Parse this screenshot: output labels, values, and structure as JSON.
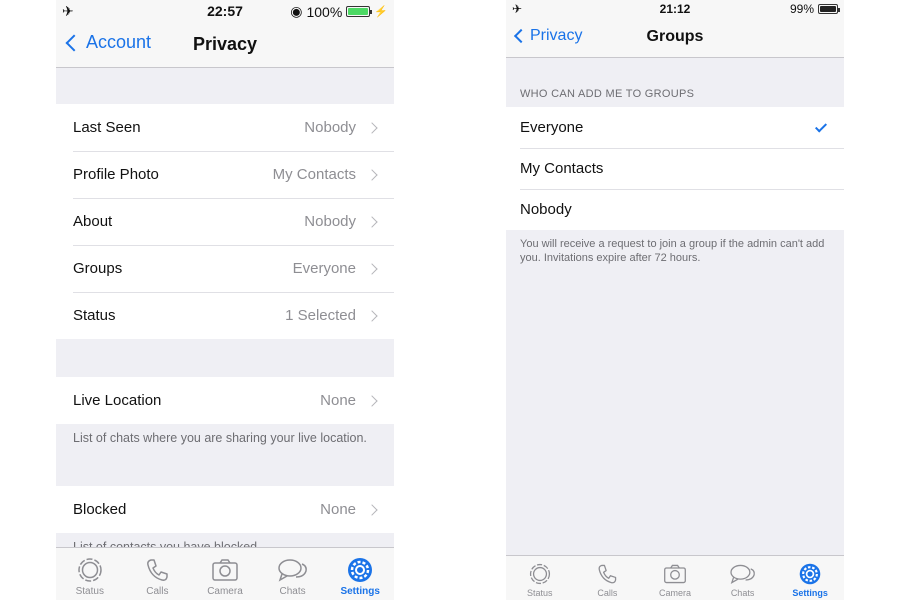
{
  "colors": {
    "accent": "#1a73e8",
    "battery_green": "#4cd964",
    "battery_dark": "#222222"
  },
  "left": {
    "statusbar": {
      "time": "22:57",
      "battery": "100%",
      "battery_level": 1.0
    },
    "nav": {
      "back_label": "Account",
      "title": "Privacy"
    },
    "rows": [
      {
        "label": "Last Seen",
        "value": "Nobody"
      },
      {
        "label": "Profile Photo",
        "value": "My Contacts"
      },
      {
        "label": "About",
        "value": "Nobody"
      },
      {
        "label": "Groups",
        "value": "Everyone"
      },
      {
        "label": "Status",
        "value": "1 Selected"
      }
    ],
    "live_location": {
      "label": "Live Location",
      "value": "None",
      "footer": "List of chats where you are sharing your live location."
    },
    "blocked": {
      "label": "Blocked",
      "value": "None",
      "footer": "List of contacts you have blocked."
    },
    "tabs": [
      {
        "label": "Status",
        "icon": "status-icon"
      },
      {
        "label": "Calls",
        "icon": "phone-icon"
      },
      {
        "label": "Camera",
        "icon": "camera-icon"
      },
      {
        "label": "Chats",
        "icon": "chat-bubbles-icon"
      },
      {
        "label": "Settings",
        "icon": "gear-icon",
        "active": true
      }
    ]
  },
  "right": {
    "statusbar": {
      "time": "21:12",
      "battery": "99%",
      "battery_level": 0.99
    },
    "nav": {
      "back_label": "Privacy",
      "title": "Groups"
    },
    "section_header": "WHO CAN ADD ME TO GROUPS",
    "options": [
      {
        "label": "Everyone",
        "selected": true
      },
      {
        "label": "My Contacts",
        "selected": false
      },
      {
        "label": "Nobody",
        "selected": false
      }
    ],
    "footer": "You will receive a request to join a group if the admin can't add you. Invitations expire after 72 hours.",
    "tabs": [
      {
        "label": "Status",
        "icon": "status-icon"
      },
      {
        "label": "Calls",
        "icon": "phone-icon"
      },
      {
        "label": "Camera",
        "icon": "camera-icon"
      },
      {
        "label": "Chats",
        "icon": "chat-bubbles-icon"
      },
      {
        "label": "Settings",
        "icon": "gear-icon",
        "active": true
      }
    ]
  }
}
